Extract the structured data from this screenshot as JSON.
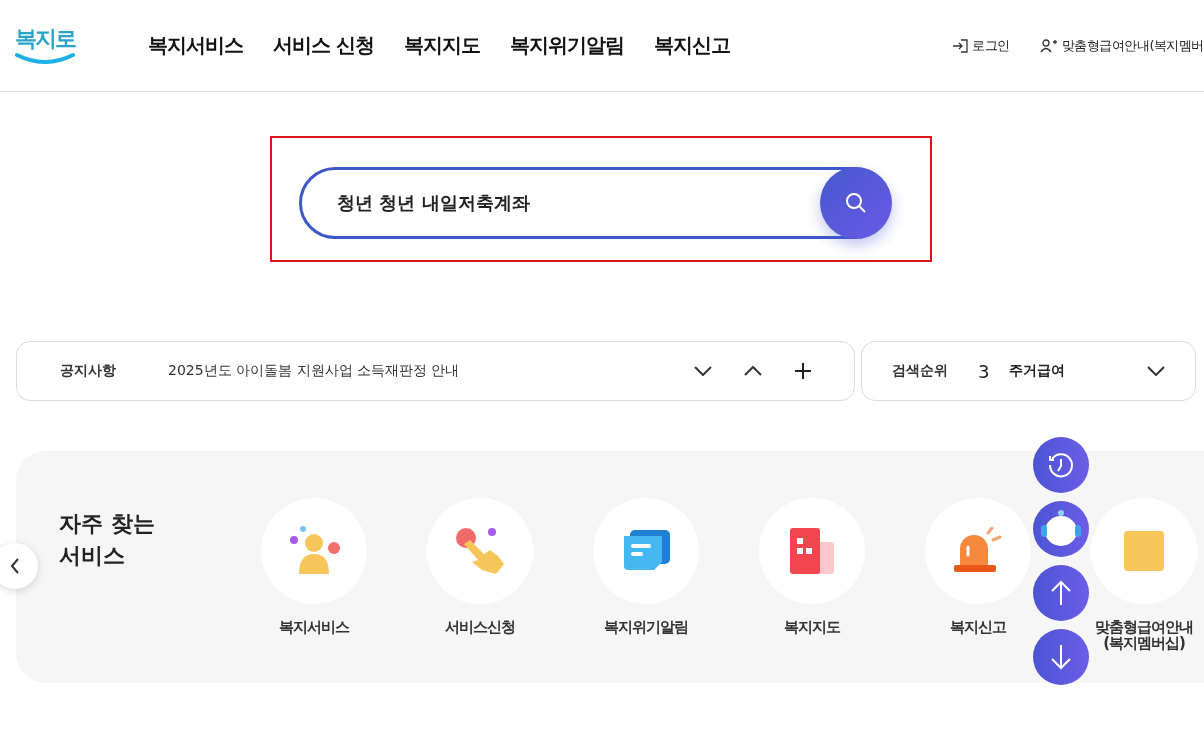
{
  "header": {
    "logo": "복지로",
    "nav": [
      "복지서비스",
      "서비스 신청",
      "복지지도",
      "복지위기알림",
      "복지신고"
    ],
    "login": "로그인",
    "member_link": "맞춤형급여안내(복지멤버"
  },
  "search": {
    "value": "청년 청년 내일저축계좌",
    "highlighted": true
  },
  "notice": {
    "label": "공지사항",
    "text": "2025년도 아이돌봄 지원사업 소득재판정 안내"
  },
  "ranking": {
    "label": "검색순위",
    "rank": "3",
    "term": "주거급여"
  },
  "frequent": {
    "title": "자주 찾는 서비스",
    "items": [
      {
        "label": "복지서비스"
      },
      {
        "label": "서비스신청"
      },
      {
        "label": "복지위기알림"
      },
      {
        "label": "복지지도"
      },
      {
        "label": "복지신고"
      },
      {
        "label": "맞춤형급여안내 (복지멤버십)"
      }
    ]
  }
}
